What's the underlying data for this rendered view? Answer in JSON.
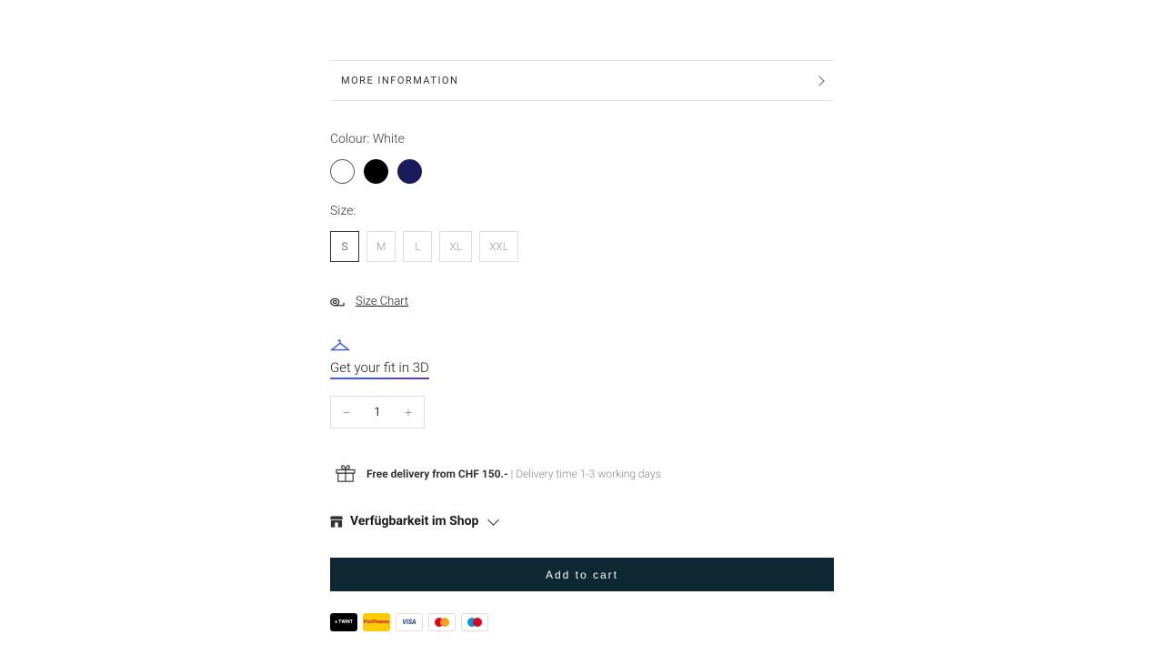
{
  "accordion": {
    "more_info": "MORE INFORMATION"
  },
  "colour": {
    "label_prefix": "Colour: ",
    "selected": "White",
    "options": [
      "White",
      "Black",
      "Navy"
    ]
  },
  "size": {
    "label": "Size:",
    "options": [
      "S",
      "M",
      "L",
      "XL",
      "XXL"
    ],
    "selected": "S"
  },
  "size_chart": {
    "label": "Size Chart"
  },
  "fit_3d": {
    "label": "Get your fit in 3D"
  },
  "quantity": {
    "value": "1"
  },
  "delivery": {
    "bold": "Free delivery from CHF 150.-",
    "separator": " | ",
    "light": "Delivery time 1-3 working days"
  },
  "availability": {
    "label": "Verfügbarkeit im Shop"
  },
  "cart": {
    "button": "Add to cart"
  },
  "payment": {
    "twint": "TWINT",
    "postfinance": "PostFinance",
    "visa": "VISA",
    "mastercard": "Mastercard",
    "maestro": "Maestro"
  }
}
